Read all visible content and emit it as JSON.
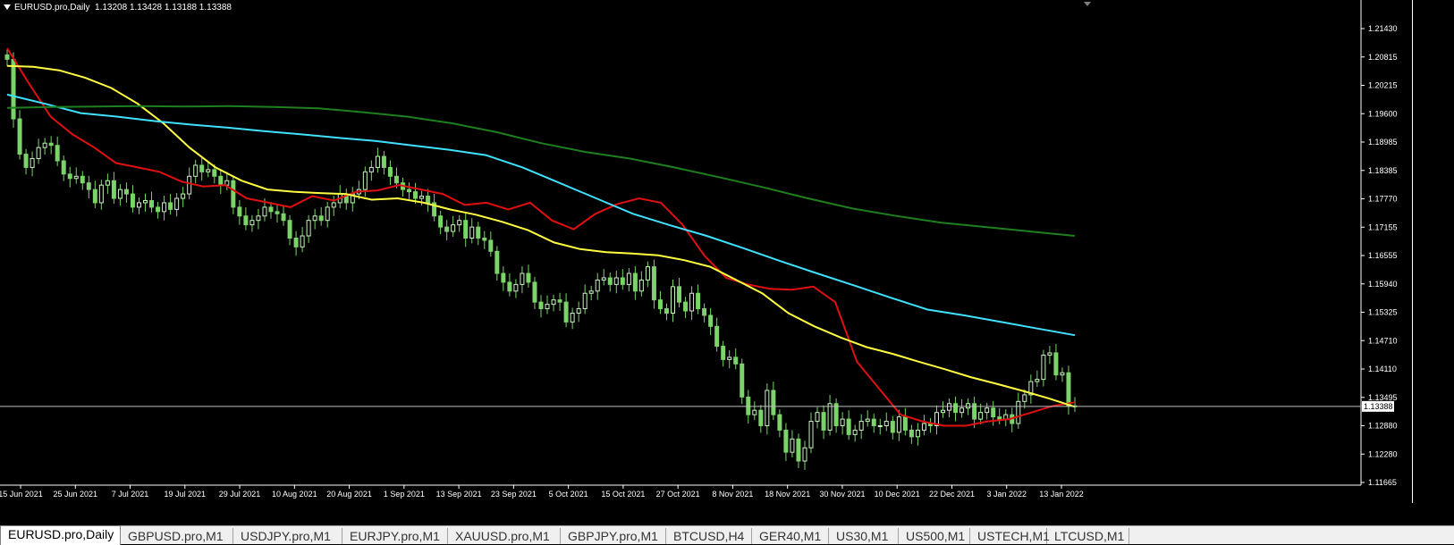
{
  "header": {
    "symbol": "EURUSD.pro,Daily",
    "ohlc": "1.13208 1.13428 1.13188 1.13388"
  },
  "current_price": "1.13388",
  "colors": {
    "background": "#000000",
    "bull_candle": "#c8f5c0",
    "bear_candle": "#7bd36a",
    "ma_red": "#e01010",
    "ma_yellow": "#ffff40",
    "ma_cyan": "#40e0ff",
    "ma_green": "#1e7f1e",
    "axis_text": "#ffffff"
  },
  "chart_data": {
    "type": "candlestick",
    "y_axis": {
      "ylim": [
        1.11665,
        1.21945
      ],
      "tick_labels": [
        "1.21430",
        "1.20815",
        "1.20215",
        "1.19600",
        "1.18985",
        "1.18385",
        "1.17770",
        "1.17155",
        "1.16555",
        "1.15940",
        "1.15325",
        "1.14710",
        "1.14110",
        "1.13495",
        "1.12880",
        "1.12280",
        "1.11665"
      ]
    },
    "x_axis": {
      "tick_labels": [
        "15 Jun 2021",
        "25 Jun 2021",
        "7 Jul 2021",
        "19 Jul 2021",
        "29 Jul 2021",
        "10 Aug 2021",
        "20 Aug 2021",
        "1 Sep 2021",
        "13 Sep 2021",
        "23 Sep 2021",
        "5 Oct 2021",
        "15 Oct 2021",
        "27 Oct 2021",
        "8 Nov 2021",
        "18 Nov 2021",
        "30 Nov 2021",
        "10 Dec 2021",
        "22 Dec 2021",
        "3 Jan 2022",
        "13 Jan 2022"
      ]
    },
    "close_approx": [
      1.2125,
      1.199,
      1.191,
      1.188,
      1.19,
      1.1925,
      1.1935,
      1.193,
      1.1895,
      1.1865,
      1.1855,
      1.186,
      1.1845,
      1.183,
      1.18,
      1.184,
      1.185,
      1.181,
      1.183,
      1.182,
      1.179,
      1.18,
      1.1805,
      1.179,
      1.178,
      1.18,
      1.1785,
      1.181,
      1.182,
      1.186,
      1.1885,
      1.187,
      1.1875,
      1.186,
      1.184,
      1.185,
      1.179,
      1.177,
      1.175,
      1.176,
      1.177,
      1.179,
      1.178,
      1.1775,
      1.176,
      1.172,
      1.17,
      1.1725,
      1.176,
      1.177,
      1.176,
      1.179,
      1.18,
      1.182,
      1.18,
      1.182,
      1.183,
      1.187,
      1.188,
      1.1905,
      1.188,
      1.186,
      1.1845,
      1.183,
      1.1825,
      1.181,
      1.1815,
      1.18,
      1.177,
      1.1745,
      1.1735,
      1.175,
      1.176,
      1.172,
      1.1745,
      1.172,
      1.1715,
      1.169,
      1.164,
      1.162,
      1.16,
      1.1615,
      1.164,
      1.162,
      1.1575,
      1.156,
      1.157,
      1.158,
      1.1575,
      1.153,
      1.155,
      1.156,
      1.1595,
      1.16,
      1.1625,
      1.163,
      1.1615,
      1.163,
      1.1615,
      1.164,
      1.16,
      1.1625,
      1.1655,
      1.158,
      1.156,
      1.155,
      1.161,
      1.1575,
      1.1555,
      1.1595,
      1.156,
      1.1545,
      1.152,
      1.1475,
      1.1445,
      1.145,
      1.1435,
      1.136,
      1.132,
      1.133,
      1.1295,
      1.1375,
      1.132,
      1.1285,
      1.1235,
      1.1265,
      1.1215,
      1.1245,
      1.1305,
      1.1325,
      1.1285,
      1.1345,
      1.1295,
      1.131,
      1.1275,
      1.1285,
      1.1305,
      1.131,
      1.1295,
      1.1295,
      1.1305,
      1.128,
      1.1315,
      1.1285,
      1.127,
      1.1285,
      1.13,
      1.1295,
      1.1325,
      1.133,
      1.1345,
      1.1325,
      1.1335,
      1.1345,
      1.131,
      1.1325,
      1.1335,
      1.1315,
      1.131,
      1.132,
      1.13,
      1.135,
      1.1365,
      1.1395,
      1.14,
      1.1455,
      1.146,
      1.141,
      1.1415,
      1.134,
      1.1338
    ],
    "series": [
      {
        "color": "#e01010",
        "values": [
          1.215,
          1.207,
          1.1995,
          1.1955,
          1.1925,
          1.189,
          1.188,
          1.187,
          1.1848,
          1.1837,
          1.184,
          1.181,
          1.18,
          1.179,
          1.1815,
          1.1805,
          1.1825,
          1.1828,
          1.184,
          1.183,
          1.182,
          1.1795,
          1.18,
          1.1785,
          1.18,
          1.176,
          1.174,
          1.1775,
          1.1797,
          1.181,
          1.18,
          1.175,
          1.168,
          1.163,
          1.1615,
          1.1605,
          1.1603,
          1.161,
          1.1575,
          1.144,
          1.138,
          1.132,
          1.1305,
          1.1295,
          1.1295,
          1.1305,
          1.131,
          1.1325,
          1.134,
          1.1348
        ]
      },
      {
        "color": "#ffff40",
        "values": [
          1.211,
          1.2108,
          1.21,
          1.2083,
          1.206,
          1.2025,
          1.198,
          1.1925,
          1.188,
          1.185,
          1.183,
          1.1825,
          1.1822,
          1.182,
          1.1807,
          1.181,
          1.18,
          1.1785,
          1.1773,
          1.1757,
          1.1738,
          1.171,
          1.1695,
          1.1688,
          1.1685,
          1.1681,
          1.167,
          1.1655,
          1.1625,
          1.1595,
          1.155,
          1.152,
          1.1495,
          1.1473,
          1.1458,
          1.144,
          1.1423,
          1.1405,
          1.139,
          1.1374,
          1.1357,
          1.1338
        ]
      },
      {
        "color": "#40e0ff",
        "values": [
          1.2045,
          1.2025,
          1.2003,
          1.1995,
          1.1985,
          1.1977,
          1.197,
          1.1962,
          1.1955,
          1.1947,
          1.194,
          1.193,
          1.192,
          1.1908,
          1.188,
          1.1845,
          1.181,
          1.1775,
          1.1749,
          1.1725,
          1.1697,
          1.1668,
          1.164,
          1.1613,
          1.1585,
          1.1558,
          1.1545,
          1.153,
          1.1515,
          1.15
        ]
      },
      {
        "color": "#1e7f1e",
        "values": [
          1.2015,
          1.2017,
          1.2018,
          1.2019,
          1.2018,
          1.2019,
          1.2017,
          1.2014,
          1.2005,
          1.1995,
          1.198,
          1.196,
          1.1935,
          1.1915,
          1.19,
          1.188,
          1.1858,
          1.1835,
          1.181,
          1.1787,
          1.177,
          1.1755,
          1.1745,
          1.1735,
          1.1725
        ]
      }
    ]
  },
  "tabs": [
    {
      "label": "EURUSD.pro,Daily",
      "active": true
    },
    {
      "label": "GBPUSD.pro,M1"
    },
    {
      "label": "USDJPY.pro,M1"
    },
    {
      "label": "EURJPY.pro,M1"
    },
    {
      "label": "XAUUSD.pro,M1"
    },
    {
      "label": "GBPJPY.pro,M1"
    },
    {
      "label": "BTCUSD,H4"
    },
    {
      "label": "GER40,M1"
    },
    {
      "label": "US30,M1"
    },
    {
      "label": "US500,M1"
    },
    {
      "label": "USTECH,M1"
    },
    {
      "label": "LTCUSD,M1"
    }
  ]
}
